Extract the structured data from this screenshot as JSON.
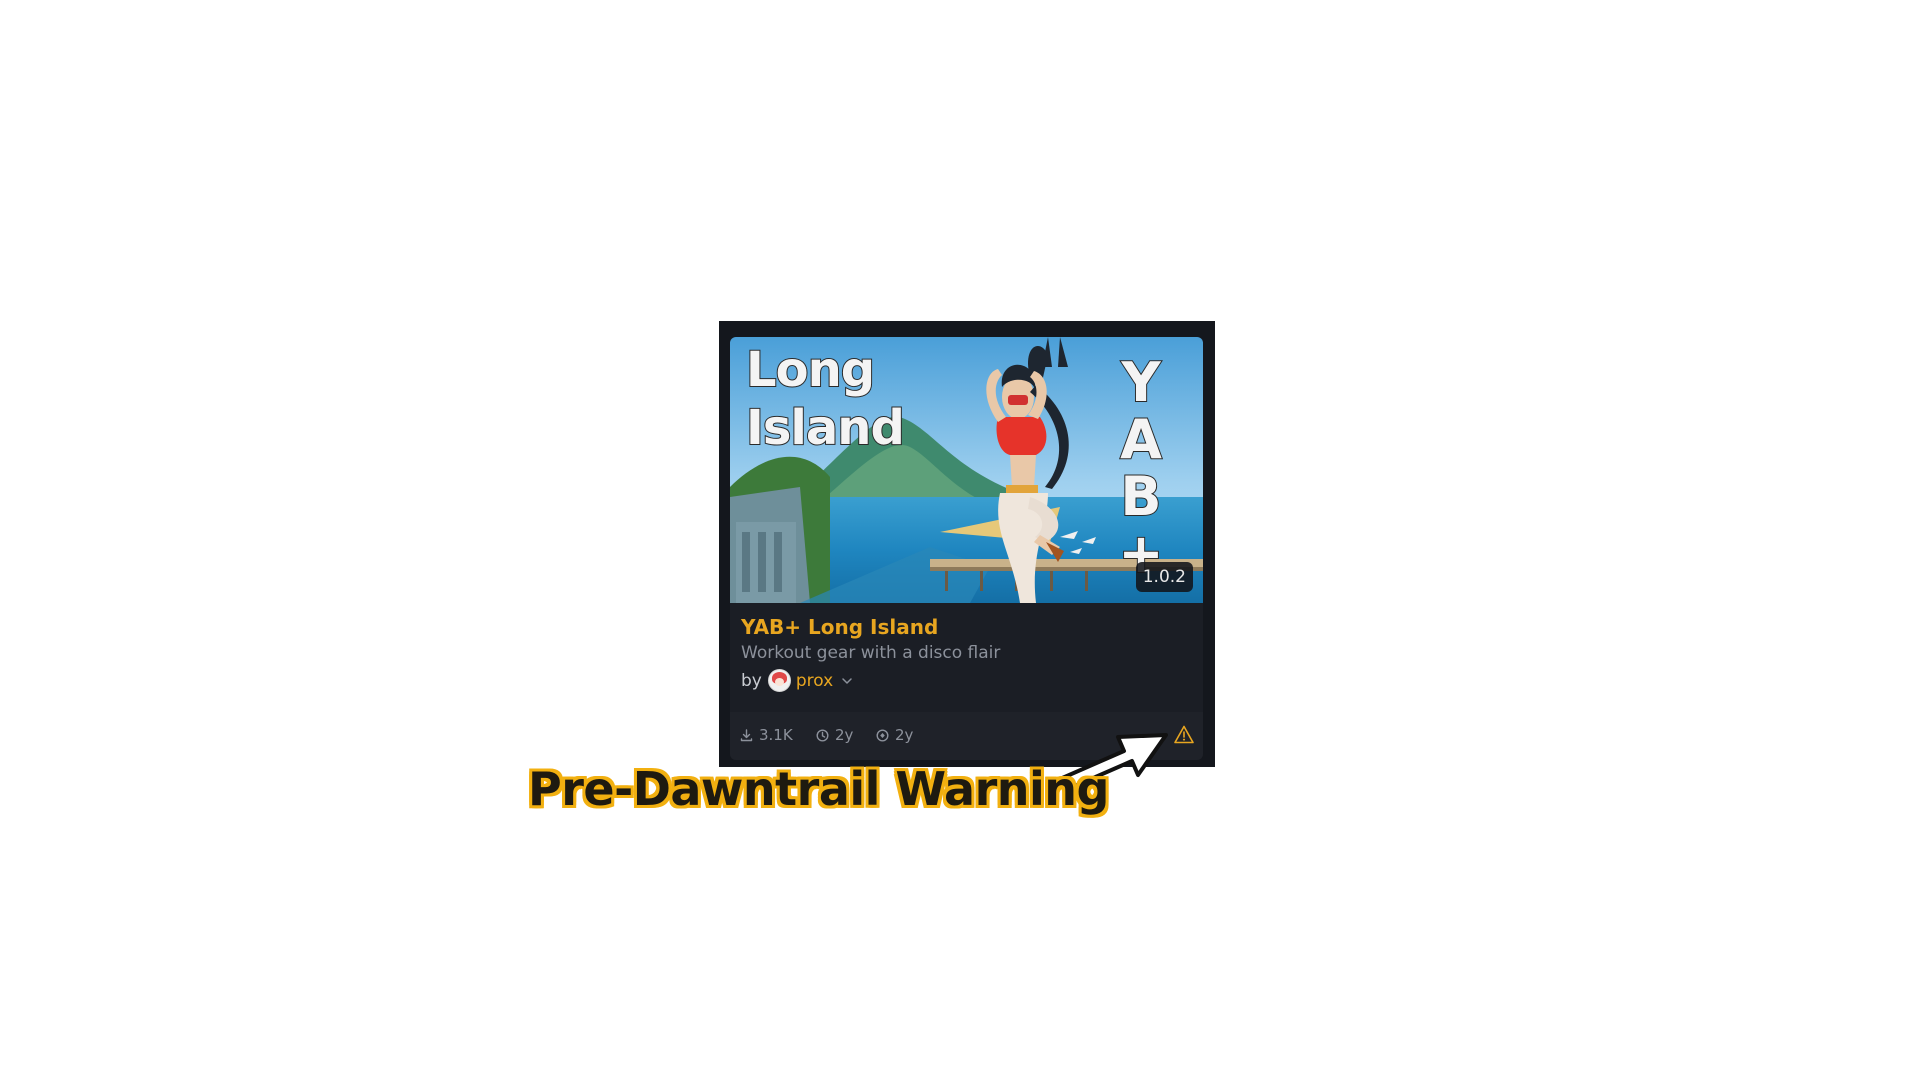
{
  "card": {
    "thumbnail": {
      "overlay_line1": "Long",
      "overlay_line2": "Island",
      "side_letters": [
        "Y",
        "A",
        "B",
        "+"
      ],
      "version": "1.0.2"
    },
    "title": "YAB+ Long Island",
    "description": "Workout gear with a disco flair",
    "author_prefix": "by",
    "author_name": "prox",
    "stats": {
      "downloads": "3.1K",
      "created": "2y",
      "updated": "2y"
    },
    "icons": {
      "downloads": "download-icon",
      "created": "clock-icon",
      "updated": "refresh-icon",
      "warning": "warning-triangle-icon",
      "author_menu": "chevron-down-icon"
    }
  },
  "annotation": {
    "label": "Pre-Dawntrail Warning"
  },
  "colors": {
    "accent": "#e8a620",
    "card_background": "#1b1e25",
    "footer_background": "#1f2229",
    "muted_text": "#8c919b",
    "warning": "#e8a620",
    "callout_outline": "#f2b010"
  }
}
